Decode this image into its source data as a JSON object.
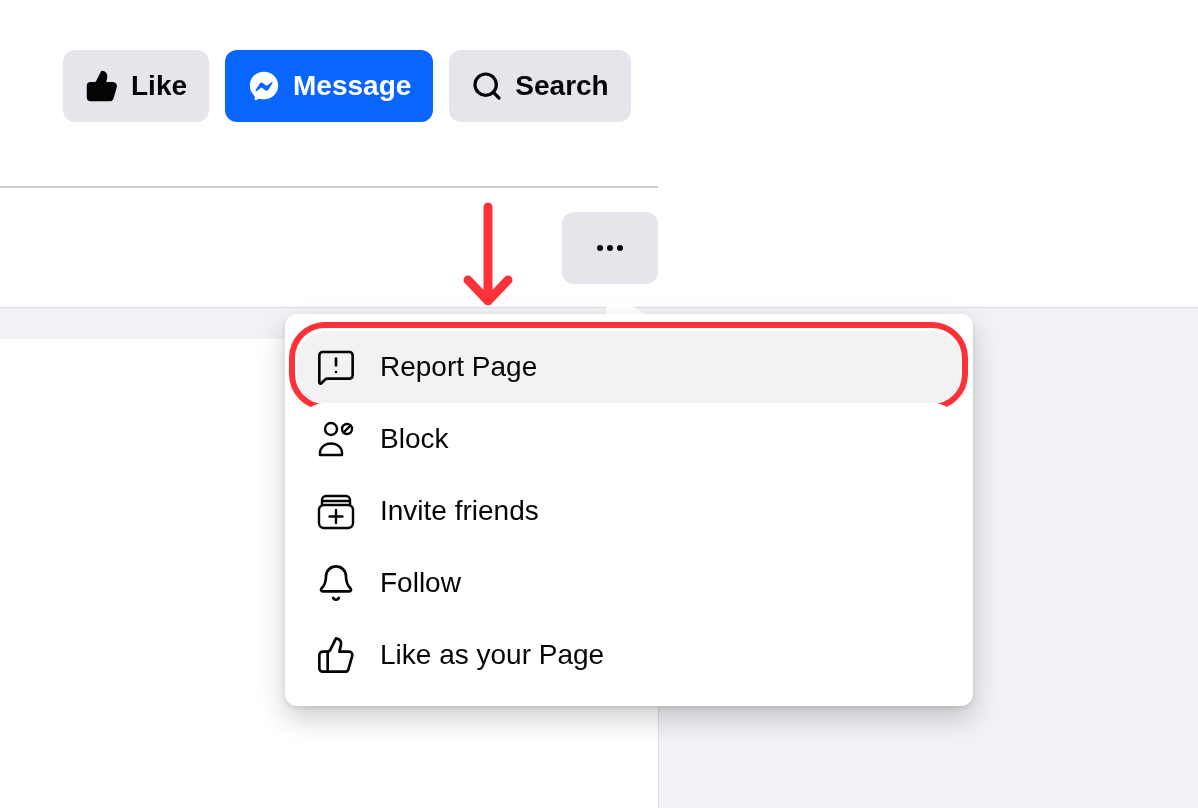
{
  "header": {
    "buttons": [
      {
        "label": "Like",
        "primary": false
      },
      {
        "label": "Message",
        "primary": true
      },
      {
        "label": "Search",
        "primary": false
      }
    ]
  },
  "menu": {
    "items": [
      {
        "label": "Report Page",
        "highlighted": true,
        "outlined": true
      },
      {
        "label": "Block",
        "highlighted": false,
        "outlined": false
      },
      {
        "label": "Invite friends",
        "highlighted": false,
        "outlined": false
      },
      {
        "label": "Follow",
        "highlighted": false,
        "outlined": false
      },
      {
        "label": "Like as your Page",
        "highlighted": false,
        "outlined": false
      }
    ]
  }
}
